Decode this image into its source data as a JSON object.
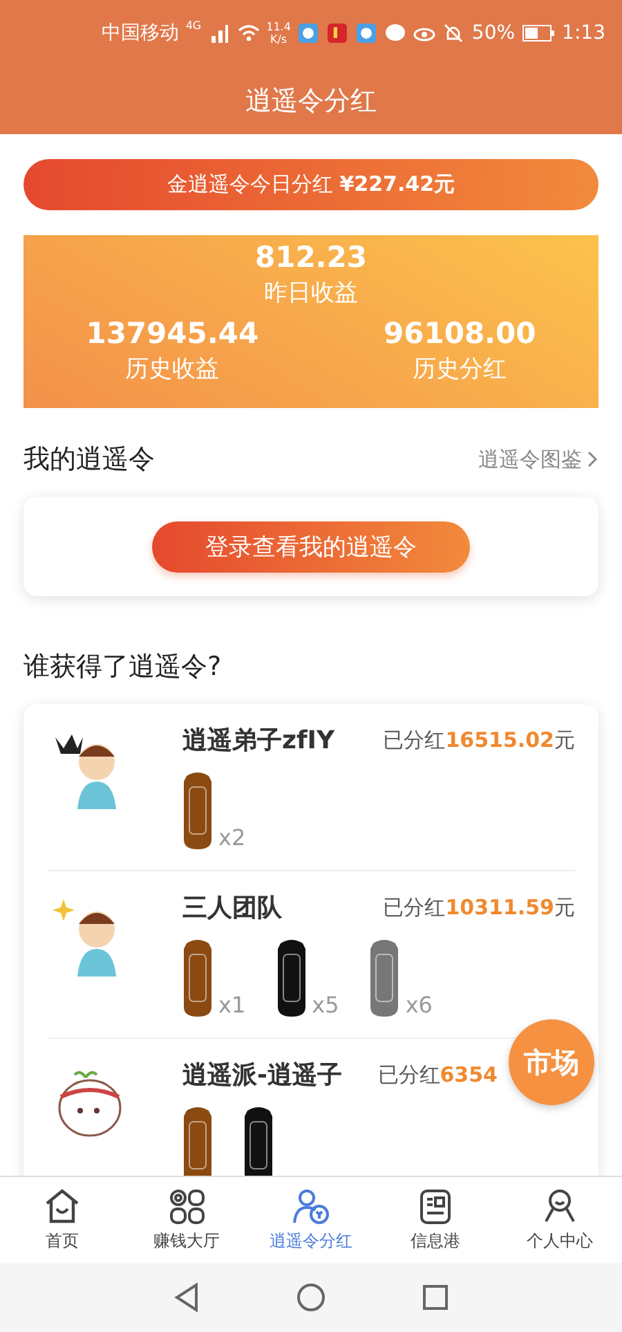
{
  "status_bar": {
    "carrier": "中国移动",
    "network": "4G",
    "speed": "11.4",
    "speed_unit": "K/s",
    "battery": "50%",
    "time": "1:13"
  },
  "title": "逍遥令分红",
  "banner": "金逍遥令今日分红 **¥227.42元**",
  "stats": {
    "main": {
      "value": "812.23",
      "label": "昨日收益"
    },
    "items": [
      {
        "value": "137945.44",
        "label": "历史收益"
      },
      {
        "value": "96108.00",
        "label": "历史分红"
      }
    ]
  },
  "my_section": {
    "title": "我的逍遥令",
    "link": "逍遥令图鉴",
    "login_button": "登录查看我的逍遥令"
  },
  "winners": {
    "title": "谁获得了逍遥令?",
    "rows": [
      {
        "name": "逍遥弟子zfIY",
        "prefix": "已分红",
        "amount": "16515.02",
        "unit": "元",
        "tokens": [
          {
            "color": "#8a4a12",
            "count": "x2"
          }
        ]
      },
      {
        "name": "三人团队",
        "prefix": "已分红",
        "amount": "10311.59",
        "unit": "元",
        "tokens": [
          {
            "color": "#8a4a12",
            "count": "x1"
          },
          {
            "color": "#111111",
            "count": "x5"
          },
          {
            "color": "#777777",
            "count": "x6"
          }
        ]
      },
      {
        "name": "逍遥派-逍遥子",
        "prefix": "已分红",
        "amount": "6354",
        "tokens": [
          {
            "color": "#8a4a12"
          },
          {
            "color": "#111111"
          }
        ]
      }
    ]
  },
  "market_button": "市场",
  "tabs": [
    {
      "label": "首页",
      "selected": false
    },
    {
      "label": "赚钱大厅",
      "selected": false
    },
    {
      "label": "逍遥令分红",
      "selected": true
    },
    {
      "label": "信息港",
      "selected": false
    },
    {
      "label": "个人中心",
      "selected": false
    }
  ]
}
